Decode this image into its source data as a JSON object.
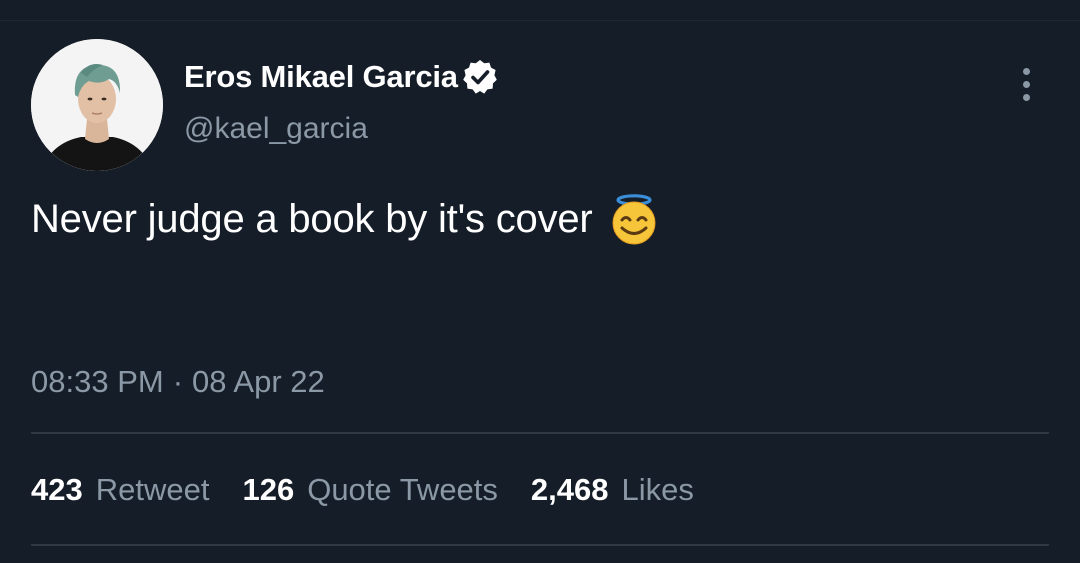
{
  "author": {
    "display_name": "Eros Mikael Garcia",
    "handle": "@kael_garcia",
    "verified": true,
    "avatar_icon": "profile-photo"
  },
  "tweet": {
    "text": "Never judge a book by it's cover",
    "emoji": "smiling-face-with-halo-icon"
  },
  "meta": {
    "time": "08:33 PM",
    "separator": "·",
    "date": "08 Apr 22"
  },
  "stats": [
    {
      "count": "423",
      "label": "Retweet"
    },
    {
      "count": "126",
      "label": "Quote Tweets"
    },
    {
      "count": "2,468",
      "label": "Likes"
    }
  ],
  "colors": {
    "background": "#151d28",
    "primary_text": "#ffffff",
    "secondary_text": "#8b98a5",
    "divider": "#2f3943"
  },
  "icons": {
    "verified": "verified-badge-icon",
    "more": "more-options-icon"
  }
}
